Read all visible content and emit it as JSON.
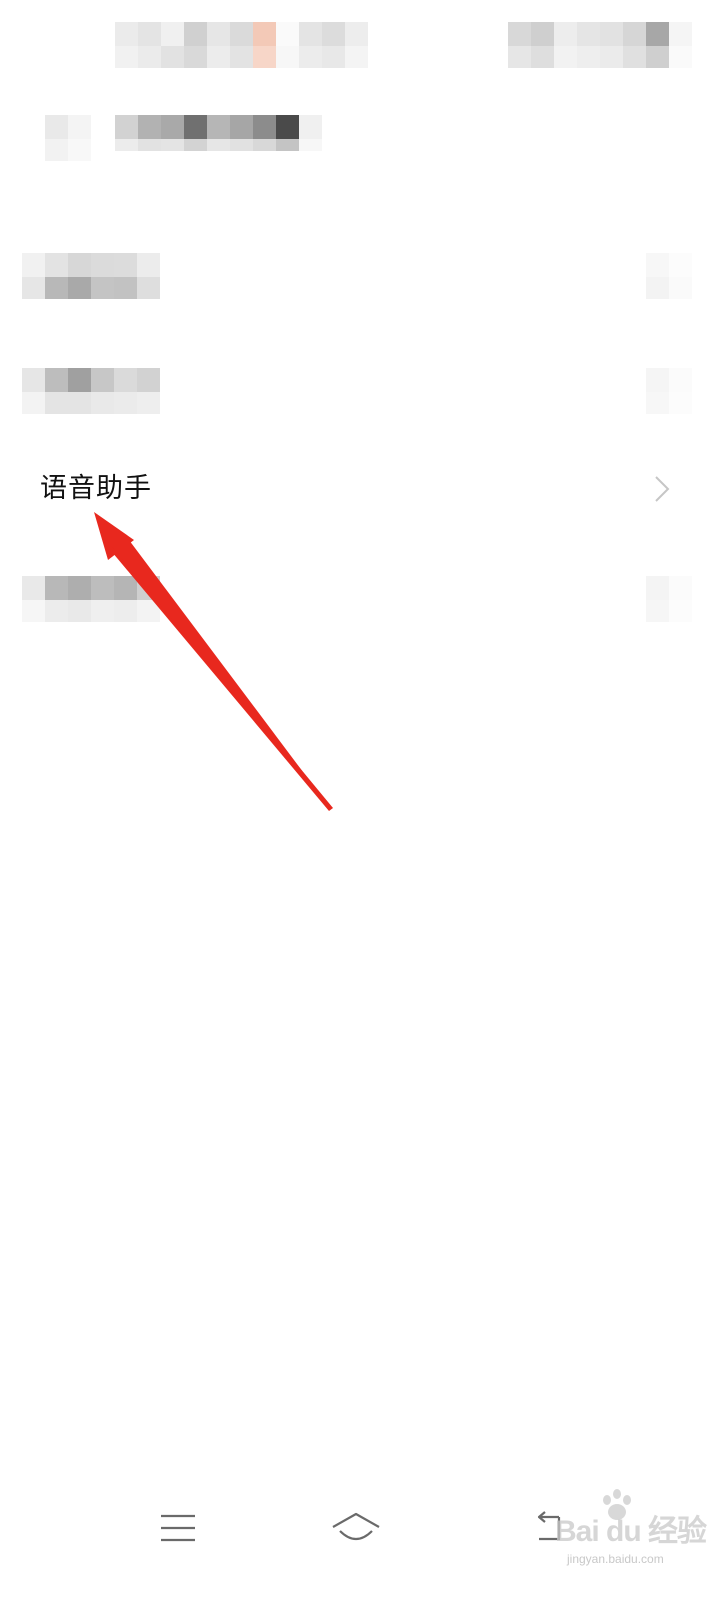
{
  "settings": {
    "voice_assistant_label": "语音助手"
  },
  "watermark": {
    "main": "Bai du 经验",
    "sub": "jingyan.baidu.com"
  },
  "colors": {
    "annotation_arrow": "#e8281e",
    "chevron": "#c6c6c6",
    "nav_icon": "#6a6a6a",
    "text": "#111111"
  },
  "icons": {
    "chevron": "chevron-right-icon",
    "nav_menu": "menu-icon",
    "nav_home": "home-icon",
    "nav_back": "back-icon"
  }
}
